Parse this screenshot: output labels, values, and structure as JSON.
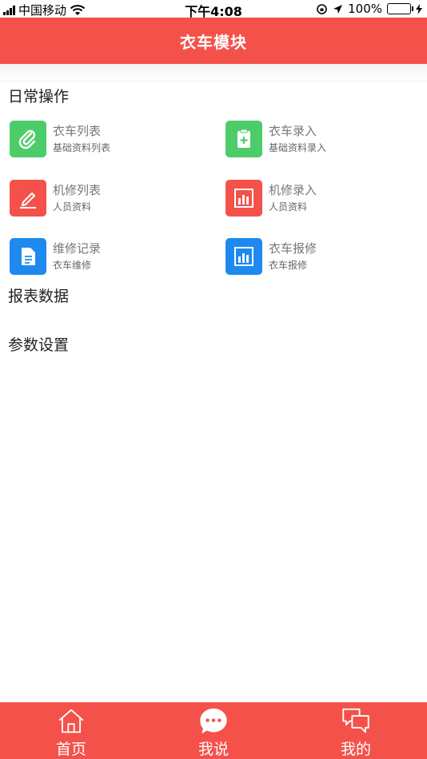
{
  "status_bar": {
    "carrier": "中国移动",
    "time": "下午4:08",
    "battery": "100%"
  },
  "nav": {
    "title": "衣车模块"
  },
  "sections": {
    "daily": "日常操作",
    "reports": "报表数据",
    "settings": "参数设置"
  },
  "items": [
    {
      "title": "衣车列表",
      "subtitle": "基础资料列表",
      "icon": "paperclip-icon",
      "color": "#4ccd6a"
    },
    {
      "title": "衣车录入",
      "subtitle": "基础资料录入",
      "icon": "clipboard-plus-icon",
      "color": "#4ccd6a"
    },
    {
      "title": "机修列表",
      "subtitle": "人员资料",
      "icon": "pencil-icon",
      "color": "#f4514a"
    },
    {
      "title": "机修录入",
      "subtitle": "人员资料",
      "icon": "bar-chart-icon",
      "color": "#f4514a"
    },
    {
      "title": "维修记录",
      "subtitle": "衣车维修",
      "icon": "document-icon",
      "color": "#1e8af0"
    },
    {
      "title": "衣车报修",
      "subtitle": "衣车报修",
      "icon": "bar-chart-icon",
      "color": "#1e8af0"
    }
  ],
  "tabs": [
    {
      "label": "首页",
      "icon": "home-icon"
    },
    {
      "label": "我说",
      "icon": "chat-bubble-icon"
    },
    {
      "label": "我的",
      "icon": "chat-windows-icon"
    }
  ]
}
